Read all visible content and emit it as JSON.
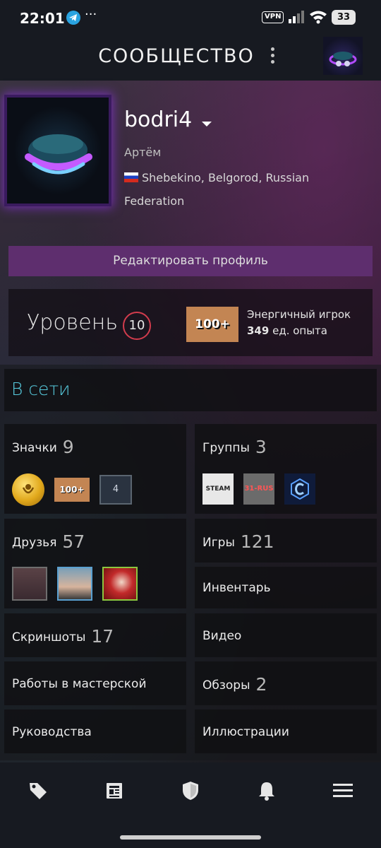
{
  "status_bar": {
    "time": "22:01",
    "vpn": "VPN",
    "battery": "33"
  },
  "top_nav": {
    "title": "СООБЩЕСТВО"
  },
  "profile": {
    "username": "bodri4",
    "real_name": "Артём",
    "location": "Shebekino, Belgorod, Russian Federation",
    "edit_button": "Редактировать профиль"
  },
  "level": {
    "label": "Уровень",
    "value": "10",
    "badge_text": "100+",
    "badge_name": "Энергичный игрок",
    "xp_value": "349",
    "xp_unit": "ед. опыта"
  },
  "online": {
    "label": "В сети"
  },
  "tiles": {
    "badges": {
      "label": "Значки",
      "count": "9",
      "item_4": "4",
      "item_100": "100+"
    },
    "groups": {
      "label": "Группы",
      "count": "3",
      "steam": "STEAM",
      "rus": "31-RUS"
    },
    "friends": {
      "label": "Друзья",
      "count": "57"
    },
    "games": {
      "label": "Игры",
      "count": "121"
    },
    "inventory": {
      "label": "Инвентарь"
    },
    "screenshots": {
      "label": "Скриншоты",
      "count": "17"
    },
    "videos": {
      "label": "Видео"
    },
    "workshop": {
      "label": "Работы в мастерской"
    },
    "reviews": {
      "label": "Обзоры",
      "count": "2"
    },
    "guides": {
      "label": "Руководства"
    },
    "artwork": {
      "label": "Иллюстрации"
    }
  },
  "colors": {
    "accent_online": "#57cbde",
    "edit_button": "#5e2e6e",
    "level_ring": "#d23c4d"
  },
  "bottom_nav": {
    "icons": [
      "tag-icon",
      "news-icon",
      "shield-icon",
      "bell-icon",
      "menu-icon"
    ]
  }
}
